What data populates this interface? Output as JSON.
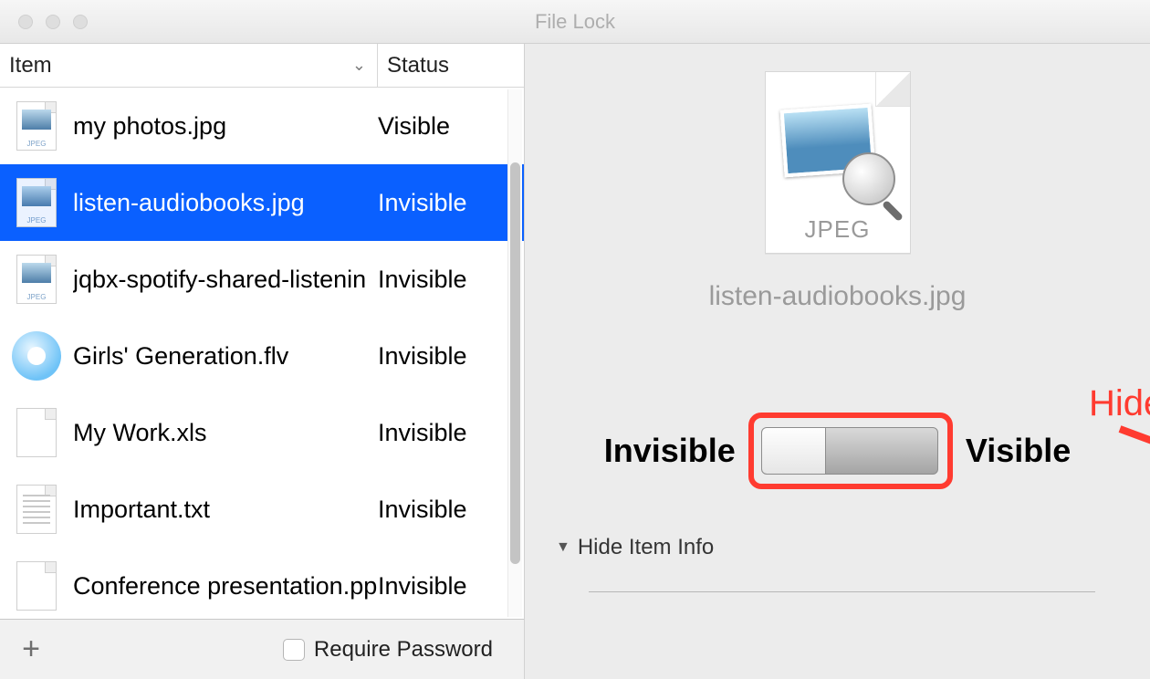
{
  "window": {
    "title": "File Lock"
  },
  "columns": {
    "item": "Item",
    "status": "Status"
  },
  "files": [
    {
      "name": "my photos.jpg",
      "status": "Visible",
      "type": "jpeg",
      "selected": false
    },
    {
      "name": "listen-audiobooks.jpg",
      "status": "Invisible",
      "type": "jpeg",
      "selected": true
    },
    {
      "name": "jqbx-spotify-shared-listenin",
      "status": "Invisible",
      "type": "jpeg",
      "selected": false
    },
    {
      "name": "Girls' Generation.flv",
      "status": "Invisible",
      "type": "flv",
      "selected": false
    },
    {
      "name": "My Work.xls",
      "status": "Invisible",
      "type": "xls",
      "selected": false
    },
    {
      "name": "Important.txt",
      "status": "Invisible",
      "type": "txt",
      "selected": false
    },
    {
      "name": "Conference presentation.pp",
      "status": "Invisible",
      "type": "xls",
      "selected": false
    }
  ],
  "footer": {
    "requirePassword": "Require Password"
  },
  "detail": {
    "iconLabel": "JPEG",
    "filename": "listen-audiobooks.jpg",
    "invisibleLabel": "Invisible",
    "visibleLabel": "Visible",
    "hideItemInfo": "Hide Item Info"
  },
  "annotation": {
    "hide": "Hide"
  }
}
